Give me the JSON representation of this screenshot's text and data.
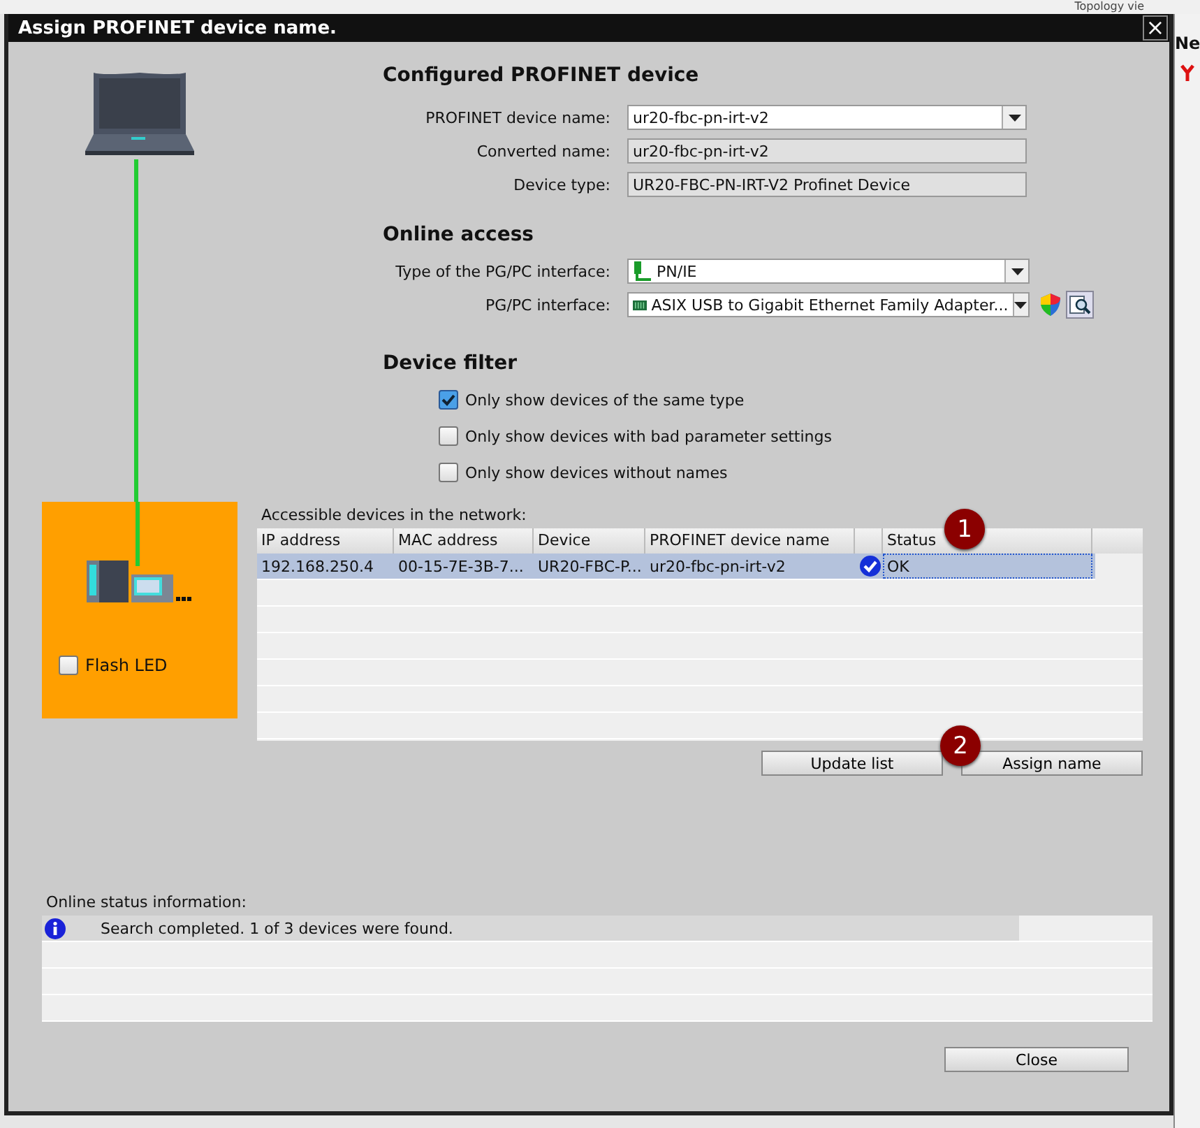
{
  "background": {
    "tab_label": "Topology vie",
    "side_label": "Ne"
  },
  "window": {
    "title": "Assign PROFINET device name.",
    "close_glyph": "×"
  },
  "device_panel": {
    "flash_led": {
      "label": "Flash LED",
      "checked": false
    }
  },
  "configured_device": {
    "heading": "Configured PROFINET device",
    "fields": [
      {
        "kind": "combo",
        "label": "PROFINET device name:",
        "value": "ur20-fbc-pn-irt-v2"
      },
      {
        "kind": "readonly",
        "label": "Converted name:",
        "value": "ur20-fbc-pn-irt-v2"
      },
      {
        "kind": "readonly",
        "label": "Device type:",
        "value": "UR20-FBC-PN-IRT-V2 Profinet Device"
      }
    ]
  },
  "online_access": {
    "heading": "Online access",
    "fields": [
      {
        "kind": "type",
        "label": "Type of the PG/PC interface:",
        "value": "PN/IE"
      },
      {
        "kind": "adapter",
        "label": "PG/PC interface:",
        "value": "ASIX USB to Gigabit Ethernet Family Adapter..."
      }
    ]
  },
  "device_filter": {
    "heading": "Device filter",
    "options": [
      {
        "label": "Only show devices of the same type",
        "checked": true
      },
      {
        "label": "Only show devices with bad parameter settings",
        "checked": false
      },
      {
        "label": "Only show devices without names",
        "checked": false
      }
    ]
  },
  "table": {
    "caption": "Accessible devices in the network:",
    "columns": [
      "IP address",
      "MAC address",
      "Device",
      "PROFINET device name",
      null,
      "Status"
    ],
    "rows": [
      {
        "selected": true,
        "cells": [
          "192.168.250.4",
          "00-15-7E-3B-7...",
          "UR20-FBC-P...",
          "ur20-fbc-pn-irt-v2",
          null,
          "OK"
        ]
      }
    ]
  },
  "buttons": [
    "Update list",
    "Assign name"
  ],
  "callouts": [
    "1",
    "2"
  ],
  "online_status": {
    "caption": "Online status information:",
    "messages": [
      {
        "kind": "info",
        "text": "Search completed. 1 of 3 devices were found."
      }
    ]
  },
  "close_button": "Close"
}
